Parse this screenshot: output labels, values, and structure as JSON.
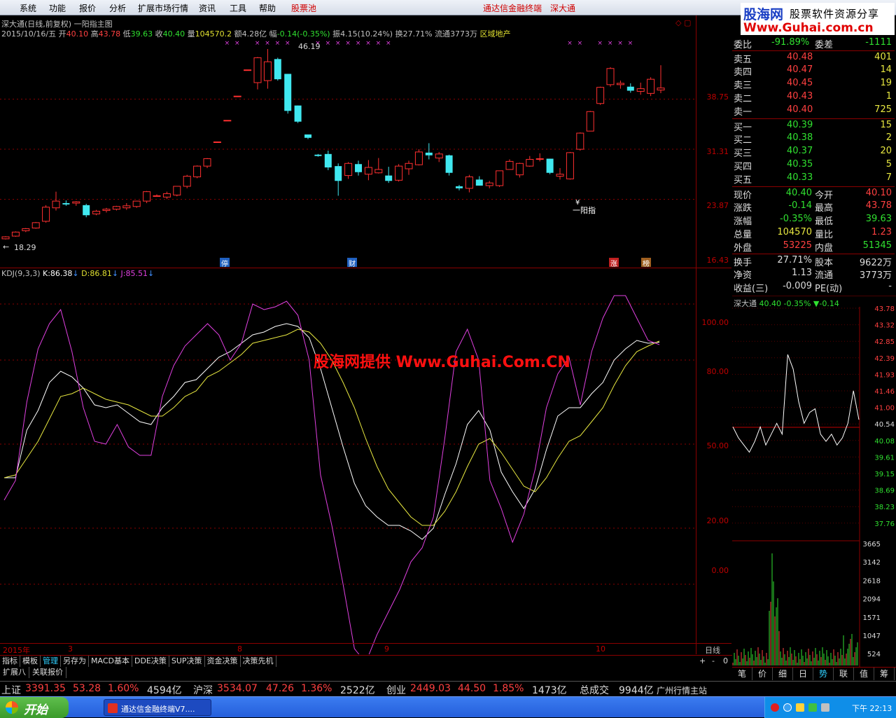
{
  "menu": {
    "items": [
      "系统",
      "功能",
      "报价",
      "分析",
      "扩展市场行情",
      "资讯",
      "工具",
      "帮助"
    ],
    "hot_item": "股票池",
    "title": "通达信金融终端",
    "stock_name": "深大通"
  },
  "logo": {
    "l1": "股海网",
    "l2": "股票软件资源分享",
    "l3": "Www.Guhai.com.cn"
  },
  "chart_header": {
    "title": "深大通(日线,前复权) 一阳指主图"
  },
  "info": {
    "date": "2015/10/16/五",
    "open_label": "开",
    "open": "40.10",
    "high_label": "高",
    "high": "43.78",
    "low_label": "低",
    "low": "39.63",
    "close_label": "收",
    "close": "40.40",
    "vol_label": "量",
    "vol": "104570.2",
    "amt_label": "额",
    "amt": "4.28亿",
    "chg_label": "幅",
    "chg": "-0.14(-0.35%)",
    "amp_label": "振",
    "amp": "4.15(10.24%)",
    "turn_label": "换",
    "turn": "27.71%",
    "float_label": "流通",
    "float": "3773万",
    "sector": "区域地产"
  },
  "price_axis": {
    "labels": [
      "38.75",
      "31.31",
      "23.87",
      "16.43"
    ]
  },
  "annotations": {
    "high_marker": "46.19",
    "low_marker": "18.29",
    "signal_text": "一阳指",
    "signal_glyph": "¥",
    "tags": [
      "停",
      "财",
      "涨",
      "榜"
    ]
  },
  "kdj": {
    "name": "KDJ(9,3,3)",
    "k_label": "K:",
    "k": "86.38",
    "d_label": "D:",
    "d": "86.81",
    "j_label": "J:",
    "j": "85.51",
    "axis": [
      "100.00",
      "80.00",
      "50.00",
      "20.00",
      "0.00"
    ]
  },
  "watermark": "股海网提供 Www.Guhai.Com.CN",
  "time_axis": [
    "2015年",
    "3",
    "8",
    "9",
    "10"
  ],
  "date_line_label": "日线",
  "zoom_buttons": [
    "+",
    "-",
    "0"
  ],
  "bottom_tabs": [
    "指标",
    "模板",
    "管理",
    "另存为",
    "MACD基本",
    "DDE决策",
    "SUP决策",
    "资金决策",
    "决策先机"
  ],
  "bottom_tabs2": [
    "扩展八",
    "关联报价"
  ],
  "quote": {
    "ratio": {
      "label": "委比",
      "value": "-91.89%",
      "label2": "委差",
      "value2": "-1111"
    },
    "sells": [
      {
        "label": "卖五",
        "price": "40.48",
        "vol": "401"
      },
      {
        "label": "卖四",
        "price": "40.47",
        "vol": "14"
      },
      {
        "label": "卖三",
        "price": "40.45",
        "vol": "19"
      },
      {
        "label": "卖二",
        "price": "40.43",
        "vol": "1"
      },
      {
        "label": "卖一",
        "price": "40.40",
        "vol": "725"
      }
    ],
    "buys": [
      {
        "label": "买一",
        "price": "40.39",
        "vol": "15"
      },
      {
        "label": "买二",
        "price": "40.38",
        "vol": "2"
      },
      {
        "label": "买三",
        "price": "40.37",
        "vol": "20"
      },
      {
        "label": "买四",
        "price": "40.35",
        "vol": "5"
      },
      {
        "label": "买五",
        "price": "40.33",
        "vol": "7"
      }
    ],
    "stats": [
      {
        "l1": "现价",
        "v1": "40.40",
        "l2": "今开",
        "v2": "40.10"
      },
      {
        "l1": "涨跌",
        "v1": "-0.14",
        "l2": "最高",
        "v2": "43.78"
      },
      {
        "l1": "涨幅",
        "v1": "-0.35%",
        "l2": "最低",
        "v2": "39.63"
      },
      {
        "l1": "总量",
        "v1": "104570",
        "l2": "量比",
        "v2": "1.23"
      },
      {
        "l1": "外盘",
        "v1": "53225",
        "l2": "内盘",
        "v2": "51345"
      }
    ],
    "stats2": [
      {
        "l1": "换手",
        "v1": "27.71%",
        "l2": "股本",
        "v2": "9622万"
      },
      {
        "l1": "净资",
        "v1": "1.13",
        "l2": "流通",
        "v2": "3773万"
      },
      {
        "l1": "收益(三)",
        "v1": "-0.009",
        "l2": "PE(动)",
        "v2": "-"
      }
    ]
  },
  "mini": {
    "name": "深大通",
    "price": "40.40",
    "pct": "-0.35%",
    "chg": "▼-0.14",
    "price_axis": [
      "43.78",
      "43.32",
      "42.85",
      "42.39",
      "41.93",
      "41.46",
      "41.00",
      "40.54",
      "40.08",
      "39.61",
      "39.15",
      "38.69",
      "38.23",
      "37.76"
    ],
    "vol_axis": [
      "3665",
      "3142",
      "2618",
      "2094",
      "1571",
      "1047",
      "524"
    ]
  },
  "right_tabs": [
    "笔",
    "价",
    "细",
    "日",
    "势",
    "联",
    "值",
    "筹"
  ],
  "status": {
    "sh_label": "上证",
    "sh": "3391.35",
    "sh_chg": "53.28",
    "sh_pct": "1.60%",
    "sh_amt": "4594亿",
    "sz_label": "沪深",
    "sz": "3534.07",
    "sz_chg": "47.26",
    "sz_pct": "1.36%",
    "sz_amt": "2522亿",
    "cy_label": "创业",
    "cy": "2449.03",
    "cy_chg": "44.50",
    "cy_pct": "1.85%",
    "cy_amt": "1473亿",
    "total_label": "总成交",
    "total": "9944亿",
    "station": "广州行情主站"
  },
  "taskbar": {
    "start": "开始",
    "item": "通达信金融终端V7....",
    "time": "下午 22:13"
  },
  "chart_data": [
    {
      "type": "candlestick",
      "title": "深大通(日线,前复权) 一阳指主图",
      "ylim": [
        16.43,
        46.19
      ],
      "note": "daily OHLC approximated from candle positions",
      "candles": [
        [
          18.0,
          18.4,
          17.9,
          18.3
        ],
        [
          18.4,
          19.1,
          18.3,
          19.0
        ],
        [
          19.2,
          19.6,
          19.0,
          19.5
        ],
        [
          19.6,
          20.5,
          19.5,
          20.4
        ],
        [
          20.6,
          23.0,
          20.4,
          22.7
        ],
        [
          22.6,
          25.0,
          22.2,
          23.6
        ],
        [
          23.3,
          23.7,
          22.9,
          23.1
        ],
        [
          23.3,
          23.6,
          22.9,
          23.5
        ],
        [
          23.0,
          23.2,
          21.2,
          21.5
        ],
        [
          21.7,
          22.3,
          21.5,
          22.1
        ],
        [
          22.2,
          22.6,
          21.9,
          22.4
        ],
        [
          22.4,
          22.9,
          22.2,
          22.8
        ],
        [
          22.6,
          23.3,
          22.3,
          22.9
        ],
        [
          22.8,
          23.6,
          22.6,
          23.6
        ],
        [
          23.6,
          25.1,
          23.3,
          25.0
        ],
        [
          24.4,
          24.6,
          24.3,
          24.4
        ],
        [
          24.2,
          25.0,
          23.9,
          24.7
        ],
        [
          24.5,
          25.8,
          24.3,
          25.8
        ],
        [
          25.8,
          27.5,
          25.5,
          27.3
        ],
        [
          27.2,
          28.9,
          27.0,
          28.8
        ],
        [
          28.8,
          30.0,
          28.5,
          29.9
        ],
        [
          32.4,
          32.4,
          32.4,
          32.4
        ],
        [
          35.6,
          35.6,
          35.6,
          35.6
        ],
        [
          39.2,
          39.2,
          39.2,
          39.2
        ],
        [
          43.1,
          43.1,
          43.1,
          43.1
        ],
        [
          41.2,
          45.0,
          40.2,
          44.9
        ],
        [
          41.5,
          46.19,
          40.3,
          44.3
        ],
        [
          44.7,
          44.9,
          41.5,
          41.7
        ],
        [
          42.5,
          42.5,
          36.6,
          37.0
        ],
        [
          37.8,
          37.8,
          35.2,
          35.4
        ],
        [
          33.5,
          33.5,
          32.8,
          33.0
        ],
        [
          30.5,
          30.6,
          30.2,
          30.3
        ],
        [
          30.6,
          31.1,
          28.2,
          28.6
        ],
        [
          28.8,
          29.2,
          24.4,
          26.6
        ],
        [
          27.4,
          29.4,
          26.9,
          29.2
        ],
        [
          29.1,
          29.6,
          27.4,
          27.9
        ],
        [
          27.6,
          29.7,
          26.7,
          28.6
        ],
        [
          27.8,
          30.0,
          27.7,
          28.3
        ],
        [
          27.4,
          28.7,
          26.3,
          26.6
        ],
        [
          26.7,
          29.1,
          26.5,
          28.8
        ],
        [
          28.4,
          29.6,
          27.5,
          29.2
        ],
        [
          29.0,
          31.3,
          28.9,
          30.9
        ],
        [
          30.8,
          32.2,
          29.8,
          30.4
        ],
        [
          30.0,
          30.9,
          29.4,
          30.6
        ],
        [
          30.4,
          30.5,
          27.4,
          27.8
        ],
        [
          25.8,
          26.0,
          25.2,
          25.5
        ],
        [
          25.5,
          27.5,
          24.9,
          27.2
        ],
        [
          26.8,
          27.3,
          25.9,
          25.9
        ],
        [
          25.9,
          26.6,
          25.5,
          26.3
        ],
        [
          25.9,
          28.1,
          25.7,
          28.1
        ],
        [
          28.3,
          29.8,
          28.3,
          29.5
        ],
        [
          27.5,
          29.3,
          27.1,
          29.2
        ],
        [
          28.8,
          30.3,
          28.7,
          29.8
        ],
        [
          29.9,
          30.7,
          29.5,
          29.9
        ],
        [
          29.9,
          29.9,
          27.6,
          27.8
        ],
        [
          27.3,
          28.5,
          26.8,
          27.6
        ],
        [
          26.9,
          30.9,
          26.8,
          30.8
        ],
        [
          31.3,
          33.8,
          31.1,
          33.7
        ],
        [
          34.0,
          37.0,
          34.0,
          36.9
        ],
        [
          38.1,
          40.6,
          37.9,
          40.5
        ],
        [
          40.9,
          43.5,
          40.6,
          43.3
        ],
        [
          40.9,
          41.5,
          40.3,
          41.1
        ],
        [
          40.6,
          41.1,
          39.7,
          40.0
        ],
        [
          39.9,
          41.2,
          39.4,
          40.3
        ],
        [
          39.6,
          42.0,
          39.2,
          41.7
        ],
        [
          40.1,
          43.78,
          39.63,
          40.4
        ]
      ]
    },
    {
      "type": "line",
      "title": "KDJ(9,3,3)",
      "ylim": [
        -20,
        110
      ],
      "series": [
        {
          "name": "K",
          "values": [
            38,
            38,
            55,
            62,
            72,
            76,
            74,
            70,
            64,
            63,
            64,
            61,
            58,
            57,
            63,
            67,
            72,
            73,
            77,
            81,
            83,
            86,
            89,
            90,
            92,
            93,
            92,
            88,
            77,
            63,
            49,
            36,
            28,
            24,
            21,
            21,
            19,
            16,
            20,
            32,
            43,
            57,
            62,
            55,
            40,
            33,
            27,
            34,
            48,
            60,
            63,
            63,
            68,
            72,
            80,
            84,
            87,
            86,
            86.38
          ]
        },
        {
          "name": "D",
          "values": [
            38,
            39,
            45,
            51,
            59,
            67,
            68,
            70,
            68,
            66,
            65,
            64,
            62,
            60,
            60,
            63,
            67,
            69,
            74,
            76,
            79,
            82,
            86,
            87,
            88,
            89,
            91,
            90,
            86,
            80,
            72,
            63,
            52,
            42,
            34,
            29,
            24,
            21,
            21,
            26,
            33,
            42,
            50,
            52,
            47,
            41,
            35,
            33,
            38,
            45,
            51,
            53,
            58,
            63,
            71,
            78,
            83,
            85,
            86.81
          ]
        },
        {
          "name": "J",
          "values": [
            30,
            37,
            65,
            84,
            93,
            98,
            83,
            63,
            51,
            50,
            57,
            49,
            46,
            46,
            67,
            78,
            85,
            89,
            93,
            89,
            80,
            86,
            100,
            98,
            99,
            101,
            96,
            80,
            39,
            21,
            0,
            -23,
            -28,
            -18,
            -10,
            -2,
            8,
            13,
            24,
            52,
            83,
            91,
            80,
            37,
            27,
            15,
            25,
            41,
            63,
            75,
            81,
            64,
            83,
            95,
            103,
            103,
            95,
            87,
            85.51
          ]
        }
      ]
    },
    {
      "type": "line",
      "title": "深大通",
      "series": [
        {
          "name": "价格",
          "values": [
            40.5,
            40.2,
            40.0,
            39.8,
            40.1,
            40.5,
            40.0,
            40.3,
            40.6,
            40.3,
            42.5,
            42.1,
            41.2,
            40.6,
            40.9,
            41.0,
            40.3,
            40.1,
            40.3,
            40.0,
            40.2,
            40.6,
            41.5,
            40.7
          ]
        }
      ]
    }
  ]
}
